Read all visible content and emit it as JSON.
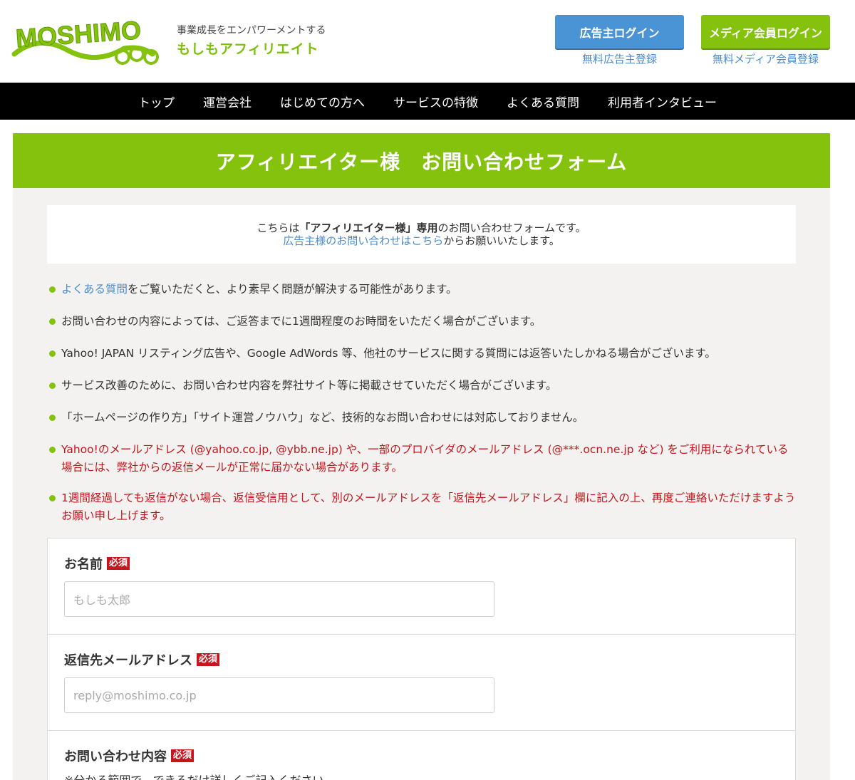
{
  "header": {
    "logo_text": "MOSHIMO",
    "tagline": "事業成長をエンパワーメントする",
    "brand_name": "もしもアフィリエイト",
    "advertiser_login_label": "広告主ログイン",
    "media_login_label": "メディア会員ログイン",
    "advertiser_register_label": "無料広告主登録",
    "media_register_label": "無料メディア会員登録"
  },
  "nav": {
    "items": [
      "トップ",
      "運営会社",
      "はじめての方へ",
      "サービスの特徴",
      "よくある質問",
      "利用者インタビュー"
    ]
  },
  "page": {
    "title": "アフィリエイター様　お問い合わせフォーム"
  },
  "notice": {
    "line1_prefix": "こちらは",
    "line1_bold": "「アフィリエイター様」専用",
    "line1_suffix": "のお問い合わせフォームです。",
    "line2_link": "広告主様のお問い合わせはこちら",
    "line2_suffix": "からお願いいたします。"
  },
  "bullets": {
    "item1_link": "よくある質問",
    "item1_rest": "をご覧いただくと、より素早く問題が解決する可能性があります。",
    "item2": "お問い合わせの内容によっては、ご返答までに1週間程度のお時間をいただく場合がございます。",
    "item3": "Yahoo! JAPAN リスティング広告や、Google AdWords 等、他社のサービスに関する質問には返答いたしかねる場合がございます。",
    "item4": "サービス改善のために、お問い合わせ内容を弊社サイト等に掲載させていただく場合がございます。",
    "item5": "「ホームページの作り方」「サイト運営ノウハウ」など、技術的なお問い合わせには対応しておりません。",
    "item6": "Yahoo!のメールアドレス (@yahoo.co.jp, @ybb.ne.jp) や、一部のプロバイダのメールアドレス (@***.ocn.ne.jp など) をご利用になられている場合には、弊社からの返信メールが正常に届かない場合があります。",
    "item7": "1週間経過しても返信がない場合、返信受信用として、別のメールアドレスを「返信先メールアドレス」欄に記入の上、再度ご連絡いただけますようお願い申し上げます。"
  },
  "form": {
    "required_badge": "必須",
    "name_label": "お名前",
    "name_placeholder": "もしも太郎",
    "email_label": "返信先メールアドレス",
    "email_placeholder": "reply@moshimo.co.jp",
    "inquiry_label": "お問い合わせ内容",
    "inquiry_hint": "※分かる範囲で、できるだけ詳しくご記入ください"
  },
  "colors": {
    "green": "#84c20e",
    "blue": "#4a93d4",
    "red": "#c4161c",
    "nav_bg": "#000000"
  }
}
